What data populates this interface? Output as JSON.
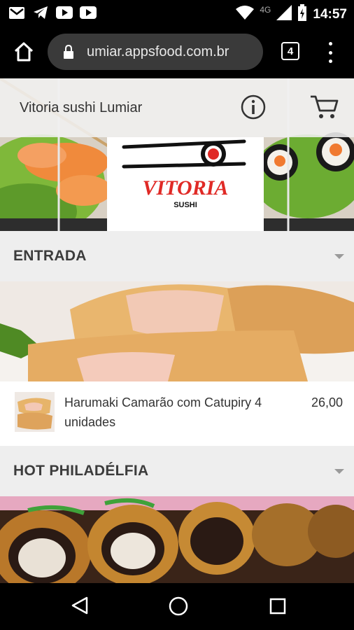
{
  "status_bar": {
    "time": "14:57",
    "network": "4G",
    "notification_icons": [
      "gmail-icon",
      "telegram-icon",
      "youtube-icon",
      "youtube-icon"
    ]
  },
  "browser": {
    "url": "umiar.appsfood.com.br",
    "tab_count": "4"
  },
  "header": {
    "store_name": "Vitoria sushi Lumiar",
    "logo_text": "VITORIA",
    "logo_subtext": "SUSHI"
  },
  "sections": [
    {
      "title": "ENTRADA",
      "items": [
        {
          "name": "Harumaki Camarão com Catupiry 4 unidades",
          "price": "26,00"
        }
      ]
    },
    {
      "title": "HOT PHILADÉLFIA",
      "items": []
    }
  ],
  "colors": {
    "brand_red": "#e02a26",
    "section_bg": "#eeeeee",
    "chrome_bg": "#000000"
  }
}
